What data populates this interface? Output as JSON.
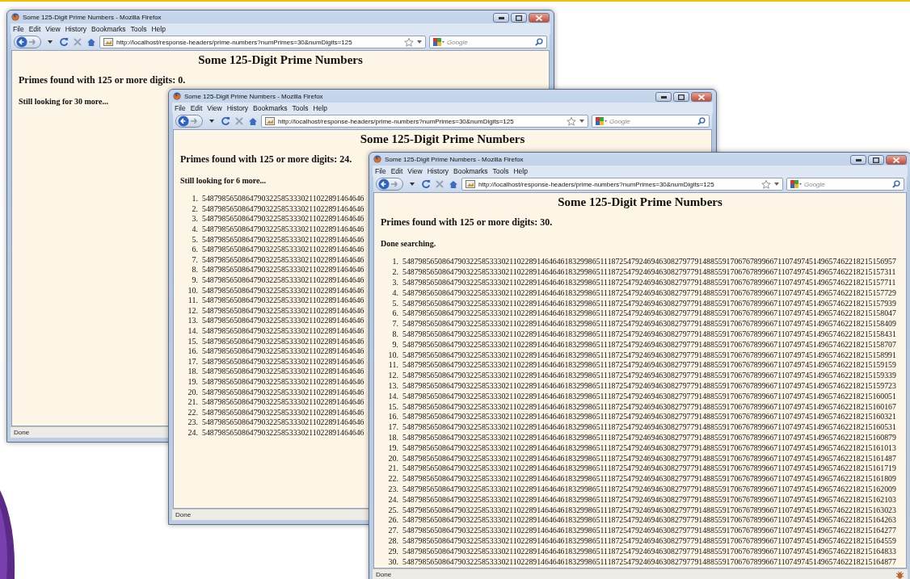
{
  "windows": [
    {
      "title": "Some 125-Digit Prime Numbers - Mozilla Firefox",
      "menu": [
        "File",
        "Edit",
        "View",
        "History",
        "Bookmarks",
        "Tools",
        "Help"
      ],
      "url": "http://localhost/response-headers/prime-numbers?numPrimes=30&numDigits=125",
      "search_placeholder": "Google",
      "heading": "Some 125-Digit Prime Numbers",
      "found": "Primes found with 125 or more digits: 0.",
      "progress": "Still looking for 30 more...",
      "status": "Done"
    },
    {
      "title": "Some 125-Digit Prime Numbers - Mozilla Firefox",
      "menu": [
        "File",
        "Edit",
        "View",
        "History",
        "Bookmarks",
        "Tools",
        "Help"
      ],
      "url": "http://localhost/response-headers/prime-numbers?numPrimes=30&numDigits=125",
      "search_placeholder": "Google",
      "heading": "Some 125-Digit Prime Numbers",
      "found": "Primes found with 125 or more digits: 24.",
      "progress": "Still looking for 6 more...",
      "primes": [
        {
          "index": "1.",
          "value": "54879856508647903225853330211022891464646"
        },
        {
          "index": "2.",
          "value": "54879856508647903225853330211022891464646"
        },
        {
          "index": "3.",
          "value": "54879856508647903225853330211022891464646"
        },
        {
          "index": "4.",
          "value": "54879856508647903225853330211022891464646"
        },
        {
          "index": "5.",
          "value": "54879856508647903225853330211022891464646"
        },
        {
          "index": "6.",
          "value": "54879856508647903225853330211022891464646"
        },
        {
          "index": "7.",
          "value": "54879856508647903225853330211022891464646"
        },
        {
          "index": "8.",
          "value": "54879856508647903225853330211022891464646"
        },
        {
          "index": "9.",
          "value": "54879856508647903225853330211022891464646"
        },
        {
          "index": "10.",
          "value": "54879856508647903225853330211022891464646"
        },
        {
          "index": "11.",
          "value": "54879856508647903225853330211022891464646"
        },
        {
          "index": "12.",
          "value": "54879856508647903225853330211022891464646"
        },
        {
          "index": "13.",
          "value": "54879856508647903225853330211022891464646"
        },
        {
          "index": "14.",
          "value": "54879856508647903225853330211022891464646"
        },
        {
          "index": "15.",
          "value": "54879856508647903225853330211022891464646"
        },
        {
          "index": "16.",
          "value": "54879856508647903225853330211022891464646"
        },
        {
          "index": "17.",
          "value": "54879856508647903225853330211022891464646"
        },
        {
          "index": "18.",
          "value": "54879856508647903225853330211022891464646"
        },
        {
          "index": "19.",
          "value": "54879856508647903225853330211022891464646"
        },
        {
          "index": "20.",
          "value": "54879856508647903225853330211022891464646"
        },
        {
          "index": "21.",
          "value": "54879856508647903225853330211022891464646"
        },
        {
          "index": "22.",
          "value": "54879856508647903225853330211022891464646"
        },
        {
          "index": "23.",
          "value": "54879856508647903225853330211022891464646"
        },
        {
          "index": "24.",
          "value": "54879856508647903225853330211022891464646"
        }
      ],
      "status": "Done"
    },
    {
      "title": "Some 125-Digit Prime Numbers - Mozilla Firefox",
      "menu": [
        "File",
        "Edit",
        "View",
        "History",
        "Bookmarks",
        "Tools",
        "Help"
      ],
      "url": "http://localhost/response-headers/prime-numbers?numPrimes=30&numDigits=125",
      "search_placeholder": "Google",
      "heading": "Some 125-Digit Prime Numbers",
      "found": "Primes found with 125 or more digits: 30.",
      "progress": "Done searching.",
      "primes": [
        {
          "index": "1.",
          "value": "54879856508647903225853330211022891464646183299865111872547924694630827977914885591706767899667110749745149657462218215156957"
        },
        {
          "index": "2.",
          "value": "54879856508647903225853330211022891464646183299865111872547924694630827977914885591706767899667110749745149657462218215157311"
        },
        {
          "index": "3.",
          "value": "54879856508647903225853330211022891464646183299865111872547924694630827977914885591706767899667110749745149657462218215157711"
        },
        {
          "index": "4.",
          "value": "54879856508647903225853330211022891464646183299865111872547924694630827977914885591706767899667110749745149657462218215157729"
        },
        {
          "index": "5.",
          "value": "54879856508647903225853330211022891464646183299865111872547924694630827977914885591706767899667110749745149657462218215157939"
        },
        {
          "index": "6.",
          "value": "54879856508647903225853330211022891464646183299865111872547924694630827977914885591706767899667110749745149657462218215158047"
        },
        {
          "index": "7.",
          "value": "54879856508647903225853330211022891464646183299865111872547924694630827977914885591706767899667110749745149657462218215158409"
        },
        {
          "index": "8.",
          "value": "54879856508647903225853330211022891464646183299865111872547924694630827977914885591706767899667110749745149657462218215158431"
        },
        {
          "index": "9.",
          "value": "54879856508647903225853330211022891464646183299865111872547924694630827977914885591706767899667110749745149657462218215158707"
        },
        {
          "index": "10.",
          "value": "54879856508647903225853330211022891464646183299865111872547924694630827977914885591706767899667110749745149657462218215158991"
        },
        {
          "index": "11.",
          "value": "54879856508647903225853330211022891464646183299865111872547924694630827977914885591706767899667110749745149657462218215159159"
        },
        {
          "index": "12.",
          "value": "54879856508647903225853330211022891464646183299865111872547924694630827977914885591706767899667110749745149657462218215159339"
        },
        {
          "index": "13.",
          "value": "54879856508647903225853330211022891464646183299865111872547924694630827977914885591706767899667110749745149657462218215159723"
        },
        {
          "index": "14.",
          "value": "54879856508647903225853330211022891464646183299865111872547924694630827977914885591706767899667110749745149657462218215160051"
        },
        {
          "index": "15.",
          "value": "54879856508647903225853330211022891464646183299865111872547924694630827977914885591706767899667110749745149657462218215160167"
        },
        {
          "index": "16.",
          "value": "54879856508647903225853330211022891464646183299865111872547924694630827977914885591706767899667110749745149657462218215160321"
        },
        {
          "index": "17.",
          "value": "54879856508647903225853330211022891464646183299865111872547924694630827977914885591706767899667110749745149657462218215160531"
        },
        {
          "index": "18.",
          "value": "54879856508647903225853330211022891464646183299865111872547924694630827977914885591706767899667110749745149657462218215160879"
        },
        {
          "index": "19.",
          "value": "54879856508647903225853330211022891464646183299865111872547924694630827977914885591706767899667110749745149657462218215161013"
        },
        {
          "index": "20.",
          "value": "54879856508647903225853330211022891464646183299865111872547924694630827977914885591706767899667110749745149657462218215161487"
        },
        {
          "index": "21.",
          "value": "54879856508647903225853330211022891464646183299865111872547924694630827977914885591706767899667110749745149657462218215161719"
        },
        {
          "index": "22.",
          "value": "54879856508647903225853330211022891464646183299865111872547924694630827977914885591706767899667110749745149657462218215161809"
        },
        {
          "index": "23.",
          "value": "54879856508647903225853330211022891464646183299865111872547924694630827977914885591706767899667110749745149657462218215162009"
        },
        {
          "index": "24.",
          "value": "54879856508647903225853330211022891464646183299865111872547924694630827977914885591706767899667110749745149657462218215162103"
        },
        {
          "index": "25.",
          "value": "54879856508647903225853330211022891464646183299865111872547924694630827977914885591706767899667110749745149657462218215163023"
        },
        {
          "index": "26.",
          "value": "54879856508647903225853330211022891464646183299865111872547924694630827977914885591706767899667110749745149657462218215164263"
        },
        {
          "index": "27.",
          "value": "54879856508647903225853330211022891464646183299865111872547924694630827977914885591706767899667110749745149657462218215164277"
        },
        {
          "index": "28.",
          "value": "54879856508647903225853330211022891464646183299865111872547924694630827977914885591706767899667110749745149657462218215164559"
        },
        {
          "index": "29.",
          "value": "54879856508647903225853330211022891464646183299865111872547924694630827977914885591706767899667110749745149657462218215164833"
        },
        {
          "index": "30.",
          "value": "54879856508647903225853330211022891464646183299865111872547924694630827977914885591706767899667110749745149657462218215164877"
        }
      ],
      "status": "Done"
    }
  ]
}
